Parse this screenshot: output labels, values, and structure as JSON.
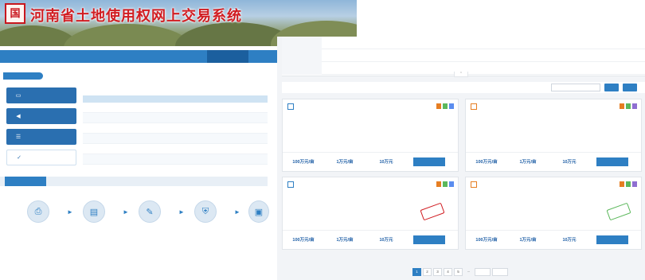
{
  "site": {
    "title": "河南省土地使用权网上交易系统",
    "logo_text": "国"
  },
  "colors": {
    "primary": "#2e7fc3",
    "title_red": "#d11d22",
    "tag_orange": "#e67e22",
    "tag_green": "#5cb85c",
    "tag_blue": "#5b8def",
    "tag_purple": "#8e6fd1"
  },
  "nav": {
    "items": [
      "",
      "",
      "",
      "",
      "",
      ""
    ],
    "active_index": 5
  },
  "breadcrumb": "",
  "side_buttons": [
    {
      "label": "",
      "icon": "monitor-icon"
    },
    {
      "label": "",
      "icon": "speaker-icon"
    },
    {
      "label": "",
      "icon": "list-icon"
    },
    {
      "label": "",
      "icon": "check-circle-icon"
    }
  ],
  "table": {
    "headers": [
      "",
      "",
      "",
      "",
      ""
    ],
    "rows": [
      [
        "",
        "",
        "",
        "",
        ""
      ],
      [
        "",
        "",
        "",
        "",
        ""
      ],
      [
        "",
        "",
        "",
        "",
        ""
      ],
      [
        "",
        "",
        "",
        "",
        ""
      ],
      [
        "",
        "",
        "",
        "",
        ""
      ],
      [
        "",
        "",
        "",
        "",
        ""
      ]
    ]
  },
  "flow": {
    "tab": "",
    "steps": [
      {
        "label": "",
        "icon": "register-icon"
      },
      {
        "label": "",
        "icon": "document-icon"
      },
      {
        "label": "",
        "icon": "edit-icon"
      },
      {
        "label": "",
        "icon": "shield-icon"
      },
      {
        "label": "",
        "icon": "certificate-icon"
      }
    ]
  },
  "filters": [
    {
      "label": "",
      "options": [
        "",
        "",
        "",
        "",
        "",
        "",
        "",
        ""
      ],
      "selected": 0
    },
    {
      "label": "",
      "options": [
        "",
        "",
        "",
        "",
        "",
        "",
        "",
        "",
        ""
      ],
      "selected": 0
    },
    {
      "label": "",
      "options": [
        "",
        "",
        "",
        "",
        "",
        "",
        "",
        ""
      ],
      "selected": 0
    }
  ],
  "sort": {
    "options": [
      "",
      "",
      "",
      "",
      ""
    ],
    "search_placeholder": "",
    "search_label": "",
    "reset_label": ""
  },
  "cards": [
    {
      "type": "",
      "title": "",
      "tags": [
        "",
        "",
        ""
      ],
      "info": [
        "",
        "",
        "",
        "",
        "",
        ""
      ],
      "values": [
        {
          "n": "100万元/亩",
          "s": ""
        },
        {
          "n": "1万元/亩",
          "s": ""
        },
        {
          "n": "10万元",
          "s": ""
        }
      ],
      "button": "",
      "stamp": ""
    },
    {
      "type": "",
      "title": "",
      "tags": [
        "",
        "",
        ""
      ],
      "info": [
        "",
        "",
        "",
        "",
        "",
        ""
      ],
      "values": [
        {
          "n": "100万元/亩",
          "s": ""
        },
        {
          "n": "1万元/亩",
          "s": ""
        },
        {
          "n": "10万元",
          "s": ""
        }
      ],
      "button": "",
      "stamp": ""
    },
    {
      "type": "",
      "title": "",
      "tags": [
        "",
        "",
        ""
      ],
      "info": [
        "",
        "",
        "",
        "",
        "",
        ""
      ],
      "values": [
        {
          "n": "100万元/亩",
          "s": ""
        },
        {
          "n": "1万元/亩",
          "s": ""
        },
        {
          "n": "10万元",
          "s": ""
        }
      ],
      "button": "",
      "stamp": ""
    },
    {
      "type": "",
      "title": "",
      "tags": [
        "",
        "",
        ""
      ],
      "info": [
        "",
        "",
        "",
        "",
        "",
        ""
      ],
      "values": [
        {
          "n": "100万元/亩",
          "s": ""
        },
        {
          "n": "1万元/亩",
          "s": ""
        },
        {
          "n": "10万元",
          "s": ""
        }
      ],
      "button": "",
      "stamp": ""
    }
  ],
  "pager": {
    "pages": [
      "1",
      "2",
      "3",
      "4",
      "5",
      "..."
    ],
    "prev": "",
    "next": "",
    "current": 0
  }
}
